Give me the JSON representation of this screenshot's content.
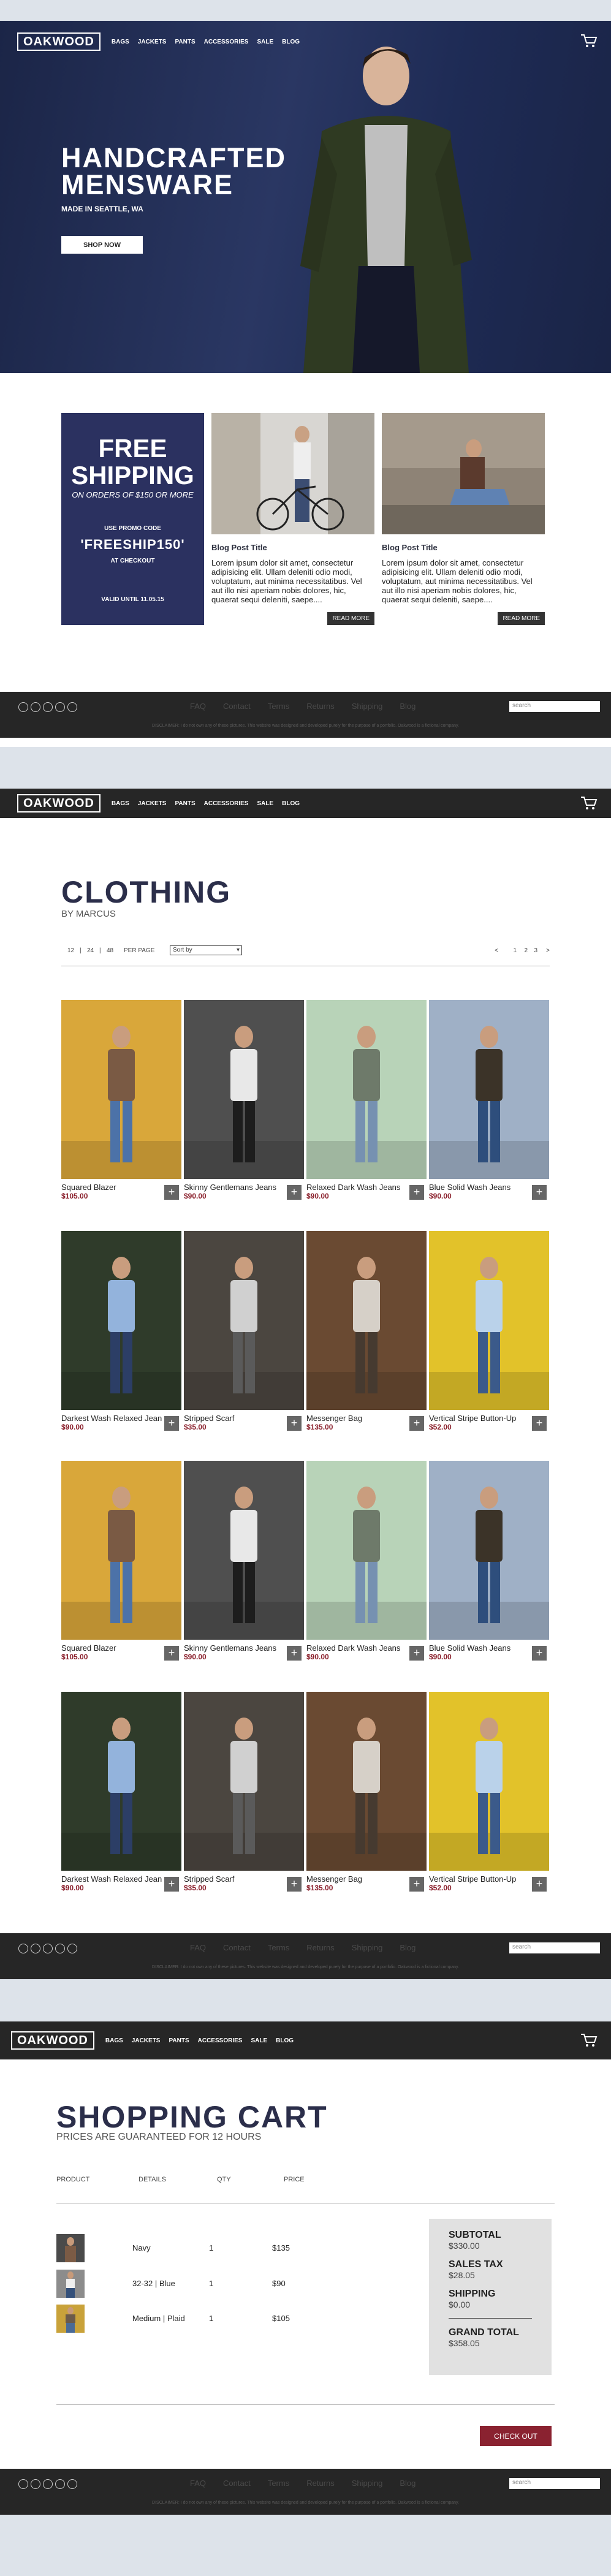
{
  "brand": "OAKWOOD",
  "nav": [
    "BAGS",
    "JACKETS",
    "PANTS",
    "ACCESSORIES",
    "SALE",
    "BLOG"
  ],
  "hero": {
    "title_line1": "HANDCRAFTED",
    "title_line2": "MENSWARE",
    "subtitle": "MADE IN SEATTLE, WA",
    "button": "SHOP NOW"
  },
  "promo": {
    "line1": "FREE",
    "line2": "SHIPPING",
    "line3": "ON ORDERS OF $150 OR MORE",
    "line4": "USE PROMO CODE",
    "code": "'FREESHIP150'",
    "line5": "AT CHECKOUT",
    "valid": "VALID UNTIL 11.05.15"
  },
  "posts": [
    {
      "title": "Blog Post Title",
      "body": "Lorem ipsum dolor sit amet, consectetur adipisicing elit. Ullam deleniti odio modi, voluptatum, aut minima necessitatibus. Vel aut illo nisi aperiam nobis dolores, hic, quaerat sequi deleniti, saepe....",
      "read_more": "READ MORE"
    },
    {
      "title": "Blog Post Title",
      "body": "Lorem ipsum dolor sit amet, consectetur adipisicing elit. Ullam deleniti odio modi, voluptatum, aut minima necessitatibus. Vel aut illo nisi aperiam nobis dolores, hic, quaerat sequi deleniti, saepe....",
      "read_more": "READ MORE"
    }
  ],
  "footer": {
    "links": [
      "FAQ",
      "Contact",
      "Terms",
      "Returns",
      "Shipping",
      "Blog"
    ],
    "search_placeholder": "search",
    "disclaimer": "DISCLAIMER: I do not own any of these pictures. This website was designed and developed purely for the purpose of a portfolio. Oakwood is a fictional company."
  },
  "clothing": {
    "title": "CLOTHING",
    "by": "BY MARCUS",
    "per_page": [
      "12",
      "24",
      "48"
    ],
    "per_page_label": "PER PAGE",
    "sort": "Sort by",
    "pager": [
      "<",
      "1",
      "2",
      "3",
      ">"
    ],
    "products": [
      {
        "name": "Squared Blazer",
        "price": "$105.00"
      },
      {
        "name": "Skinny Gentlemans Jeans",
        "price": "$90.00"
      },
      {
        "name": "Relaxed Dark Wash Jeans",
        "price": "$90.00"
      },
      {
        "name": "Blue Solid Wash Jeans",
        "price": "$90.00"
      },
      {
        "name": "Darkest Wash Relaxed Jean",
        "price": "$90.00"
      },
      {
        "name": "Stripped Scarf",
        "price": "$35.00"
      },
      {
        "name": "Messenger Bag",
        "price": "$135.00"
      },
      {
        "name": "Vertical Stripe Button-Up",
        "price": "$52.00"
      },
      {
        "name": "Squared Blazer",
        "price": "$105.00"
      },
      {
        "name": "Skinny Gentlemans Jeans",
        "price": "$90.00"
      },
      {
        "name": "Relaxed Dark Wash Jeans",
        "price": "$90.00"
      },
      {
        "name": "Blue Solid Wash Jeans",
        "price": "$90.00"
      },
      {
        "name": "Darkest Wash Relaxed Jean",
        "price": "$90.00"
      },
      {
        "name": "Stripped Scarf",
        "price": "$35.00"
      },
      {
        "name": "Messenger Bag",
        "price": "$135.00"
      },
      {
        "name": "Vertical Stripe Button-Up",
        "price": "$52.00"
      }
    ],
    "add_label": "+"
  },
  "cart": {
    "title": "SHOPPING CART",
    "subtitle": "PRICES ARE GUARANTEED FOR 12 HOURS",
    "headers": {
      "product": "PRODUCT",
      "details": "DETAILS",
      "qty": "QTY",
      "price": "PRICE"
    },
    "items": [
      {
        "details": "Navy",
        "qty": "1",
        "price": "$135"
      },
      {
        "details": "32-32 | Blue",
        "qty": "1",
        "price": "$90"
      },
      {
        "details": "Medium | Plaid",
        "qty": "1",
        "price": "$105"
      }
    ],
    "summary": {
      "subtotal_label": "SUBTOTAL",
      "subtotal": "$330.00",
      "tax_label": "SALES TAX",
      "tax": "$28.05",
      "ship_label": "SHIPPING",
      "ship": "$0.00",
      "grand_label": "GRAND TOTAL",
      "grand": "$358.05"
    },
    "checkout": "CHECK OUT"
  }
}
